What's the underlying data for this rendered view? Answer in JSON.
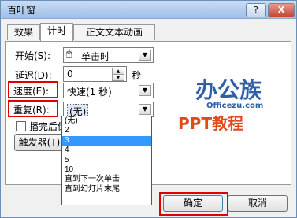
{
  "window": {
    "title": "百叶窗",
    "help_label": "?",
    "close_label": "X"
  },
  "tabs": [
    {
      "label": "效果"
    },
    {
      "label": "计时",
      "active": true
    },
    {
      "label": "正文文本动画"
    }
  ],
  "timing": {
    "start": {
      "label": "开始(S):",
      "icon": "mouse-click-icon",
      "value": "单击时"
    },
    "delay": {
      "label": "延迟(D):",
      "value": "0",
      "unit": "秒"
    },
    "speed": {
      "label": "速度(E):",
      "value": "快速(1 秒)"
    },
    "repeat": {
      "label": "重复(R):",
      "value": "(无)"
    },
    "rewind": {
      "label": "播完后倒"
    },
    "trigger": {
      "label": "触发器(T)"
    }
  },
  "repeat_options": [
    "(无)",
    "2",
    "3",
    "4",
    "5",
    "10",
    "直到下一次单击",
    "直到幻灯片末尾"
  ],
  "repeat_selected": "3",
  "logo": {
    "cn": "办公族",
    "en": "Officezu.com",
    "ppt": "PPT教程"
  },
  "buttons": {
    "ok": "确定",
    "cancel": "取消"
  },
  "colors": {
    "highlight": "#e00000",
    "selection": "#3399ff",
    "logo_blue": "#2e5fa8",
    "logo_orange": "#e04a1c"
  }
}
